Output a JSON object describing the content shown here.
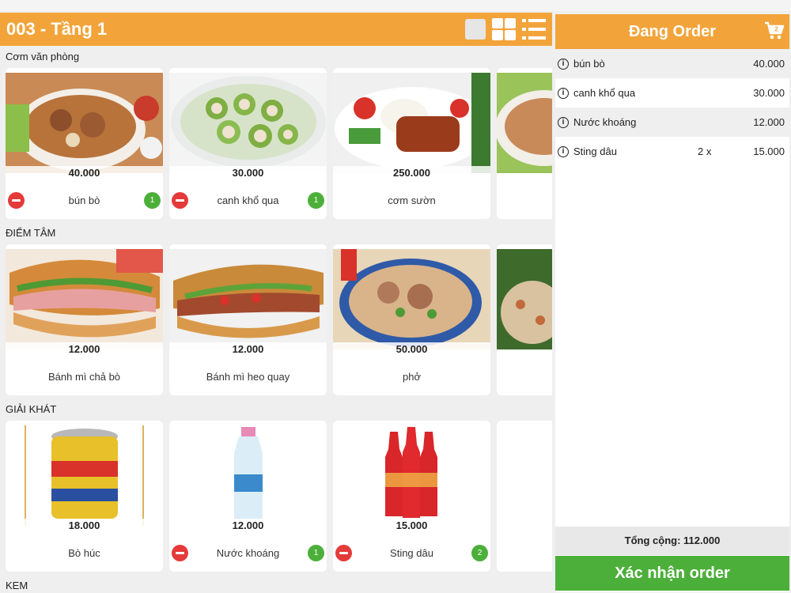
{
  "table_title": "003 - Tầng 1",
  "categories": [
    {
      "title": "Cơm văn phòng",
      "items": [
        {
          "name": "bún bò",
          "price": "40.000",
          "qty": "1"
        },
        {
          "name": "canh khổ qua",
          "price": "30.000",
          "qty": "1"
        },
        {
          "name": "cơm sườn",
          "price": "250.000",
          "qty": ""
        }
      ]
    },
    {
      "title": "ĐIỂM TÂM",
      "items": [
        {
          "name": "Bánh mì chả bò",
          "price": "12.000",
          "qty": ""
        },
        {
          "name": "Bánh mì heo quay",
          "price": "12.000",
          "qty": ""
        },
        {
          "name": "phở",
          "price": "50.000",
          "qty": ""
        }
      ]
    },
    {
      "title": "GIẢI KHÁT",
      "items": [
        {
          "name": "Bò húc",
          "price": "18.000",
          "qty": ""
        },
        {
          "name": "Nước khoáng",
          "price": "12.000",
          "qty": "1"
        },
        {
          "name": "Sting dâu",
          "price": "15.000",
          "qty": "2"
        }
      ]
    },
    {
      "title": "KEM",
      "items": []
    }
  ],
  "order": {
    "title": "Đang Order",
    "cart_count": "2",
    "items": [
      {
        "name": "bún bò",
        "qty": "",
        "price": "40.000"
      },
      {
        "name": "canh khổ qua",
        "qty": "",
        "price": "30.000"
      },
      {
        "name": "Nước khoáng",
        "qty": "",
        "price": "12.000"
      },
      {
        "name": "Sting dâu",
        "qty": "2 x",
        "price": "15.000"
      }
    ],
    "total_label": "Tổng cộng: 112.000",
    "confirm_label": "Xác nhận order"
  },
  "colors": {
    "header": "#f2a43a",
    "confirm": "#4caf3a",
    "minus": "#e53a3a"
  }
}
